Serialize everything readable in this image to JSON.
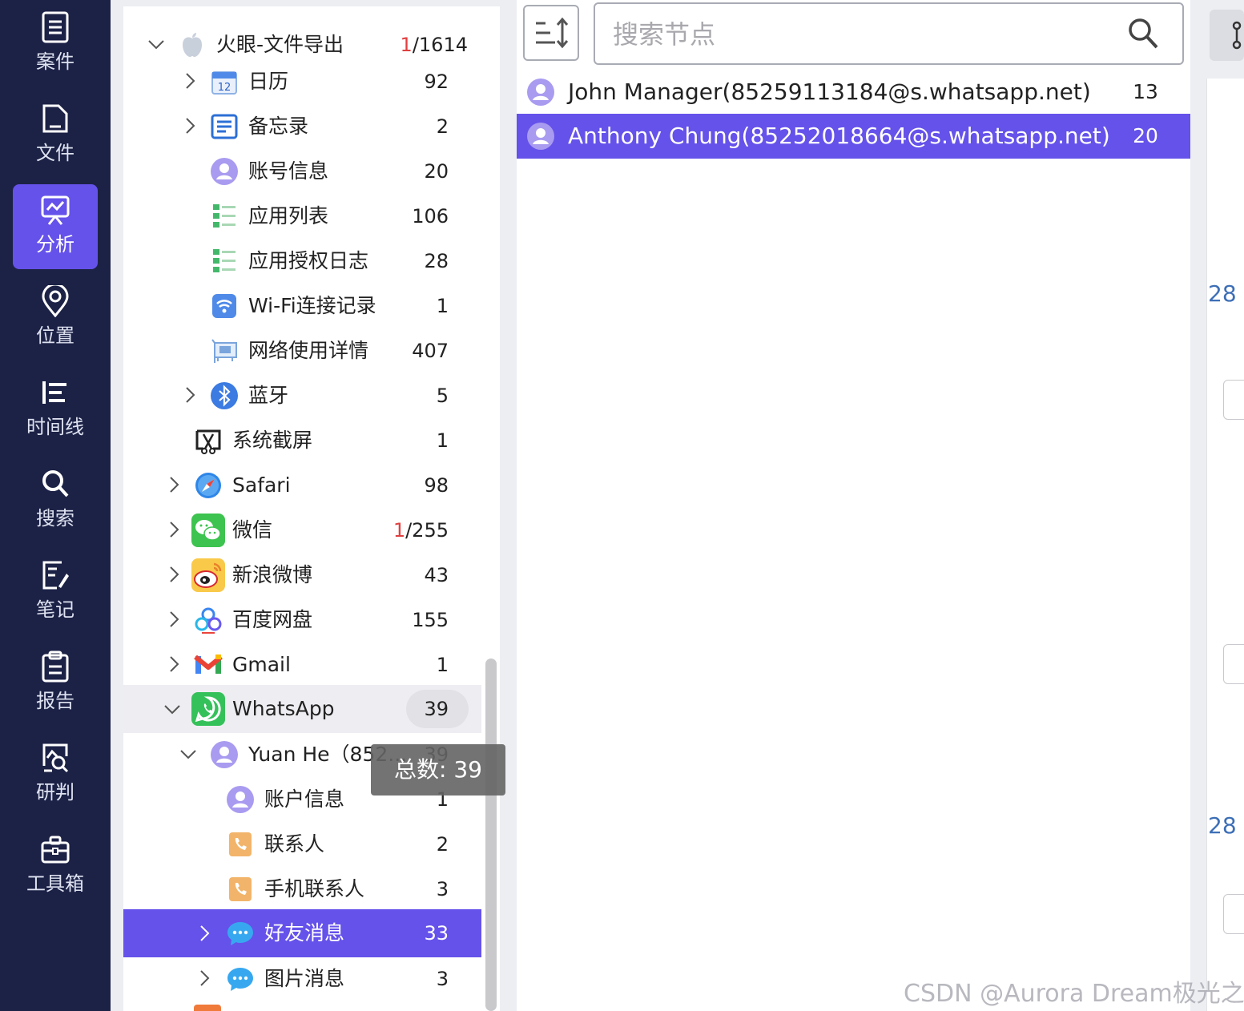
{
  "nav": {
    "items": [
      {
        "label": "案件",
        "icon": "document-list-icon"
      },
      {
        "label": "文件",
        "icon": "file-icon"
      },
      {
        "label": "分析",
        "icon": "monitor-analysis-icon",
        "active": true
      },
      {
        "label": "位置",
        "icon": "location-pin-icon"
      },
      {
        "label": "时间线",
        "icon": "timeline-icon"
      },
      {
        "label": "搜索",
        "icon": "search-icon"
      },
      {
        "label": "笔记",
        "icon": "note-edit-icon"
      },
      {
        "label": "报告",
        "icon": "clipboard-report-icon"
      },
      {
        "label": "研判",
        "icon": "chart-magnify-icon"
      },
      {
        "label": "工具箱",
        "icon": "toolbox-icon"
      }
    ]
  },
  "tree": {
    "root": {
      "label": "火眼-文件导出",
      "count_red": "1",
      "count_rest": "/1614"
    },
    "items": [
      {
        "label": "日历",
        "count": "92"
      },
      {
        "label": "备忘录",
        "count": "2"
      },
      {
        "label": "账号信息",
        "count": "20"
      },
      {
        "label": "应用列表",
        "count": "106"
      },
      {
        "label": "应用授权日志",
        "count": "28"
      },
      {
        "label": "Wi-Fi连接记录",
        "count": "1"
      },
      {
        "label": "网络使用详情",
        "count": "407"
      },
      {
        "label": "蓝牙",
        "count": "5"
      },
      {
        "label": "系统截屏",
        "count": "1"
      },
      {
        "label": "Safari",
        "count": "98"
      },
      {
        "label": "微信",
        "count_red": "1",
        "count_rest": "/255"
      },
      {
        "label": "新浪微博",
        "count": "43"
      },
      {
        "label": "百度网盘",
        "count": "155"
      },
      {
        "label": "Gmail",
        "count": "1"
      },
      {
        "label": "WhatsApp",
        "count": "39"
      },
      {
        "label": "Yuan He（852...",
        "count": "39"
      },
      {
        "label": "账户信息",
        "count": "1"
      },
      {
        "label": "联系人",
        "count": "2"
      },
      {
        "label": "手机联系人",
        "count": "3"
      },
      {
        "label": "好友消息",
        "count": "33"
      },
      {
        "label": "图片消息",
        "count": "3"
      }
    ],
    "tooltip": "总数: 39"
  },
  "middle": {
    "search_placeholder": "搜索节点",
    "contacts": [
      {
        "name": "John Manager(85259113184@s.whatsapp.net)",
        "count": "13"
      },
      {
        "name": "Anthony Chung(85252018664@s.whatsapp.net)",
        "count": "20"
      }
    ]
  },
  "right": {
    "num1": "28",
    "num2": "28"
  },
  "watermark": "CSDN @Aurora Dream极光之梦",
  "colors": {
    "accent": "#6552ea",
    "nav_bg": "#1c2246",
    "count_highlight": "#e04040"
  }
}
